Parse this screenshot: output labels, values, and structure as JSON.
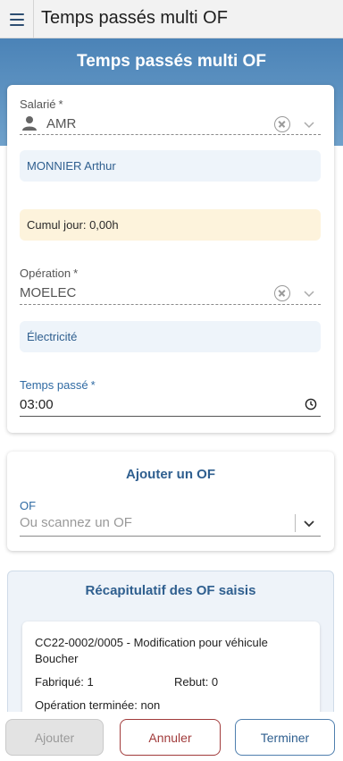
{
  "header": {
    "title": "Temps passés multi OF"
  },
  "banner": {
    "title": "Temps passés multi OF"
  },
  "employee": {
    "label": "Salarié",
    "required_mark": "*",
    "value": "AMR",
    "full_name": "MONNIER Arthur"
  },
  "daily_total": {
    "text": "Cumul jour: 0,00h"
  },
  "operation": {
    "label": "Opération",
    "required_mark": "*",
    "value": "MOELEC",
    "description": "Électricité"
  },
  "time_spent": {
    "label": "Temps passé",
    "required_mark": "*",
    "value": "03:00"
  },
  "add_of": {
    "title": "Ajouter un OF",
    "label": "OF",
    "placeholder": "Ou scannez un OF"
  },
  "summary": {
    "title": "Récapitulatif des OF saisis",
    "items": [
      {
        "line1": "CC22-0002/0005 - Modification pour véhicule",
        "line2": "Boucher",
        "fabricated": "Fabriqué: 1",
        "scrap": "Rebut: 0",
        "operation_done": "Opération terminée: non"
      }
    ]
  },
  "actions": {
    "add": "Ajouter",
    "cancel": "Annuler",
    "finish": "Terminer"
  },
  "icons": {
    "menu": "hamburger-icon",
    "person": "person-icon",
    "clear": "clear-icon",
    "dropdown": "chevron-down-icon",
    "clock": "clock-icon"
  },
  "colors": {
    "banner": "#5b92c2",
    "accent": "#2f5f8f",
    "cancel": "#a13b3b",
    "warning_bg": "#fdf3dc"
  }
}
